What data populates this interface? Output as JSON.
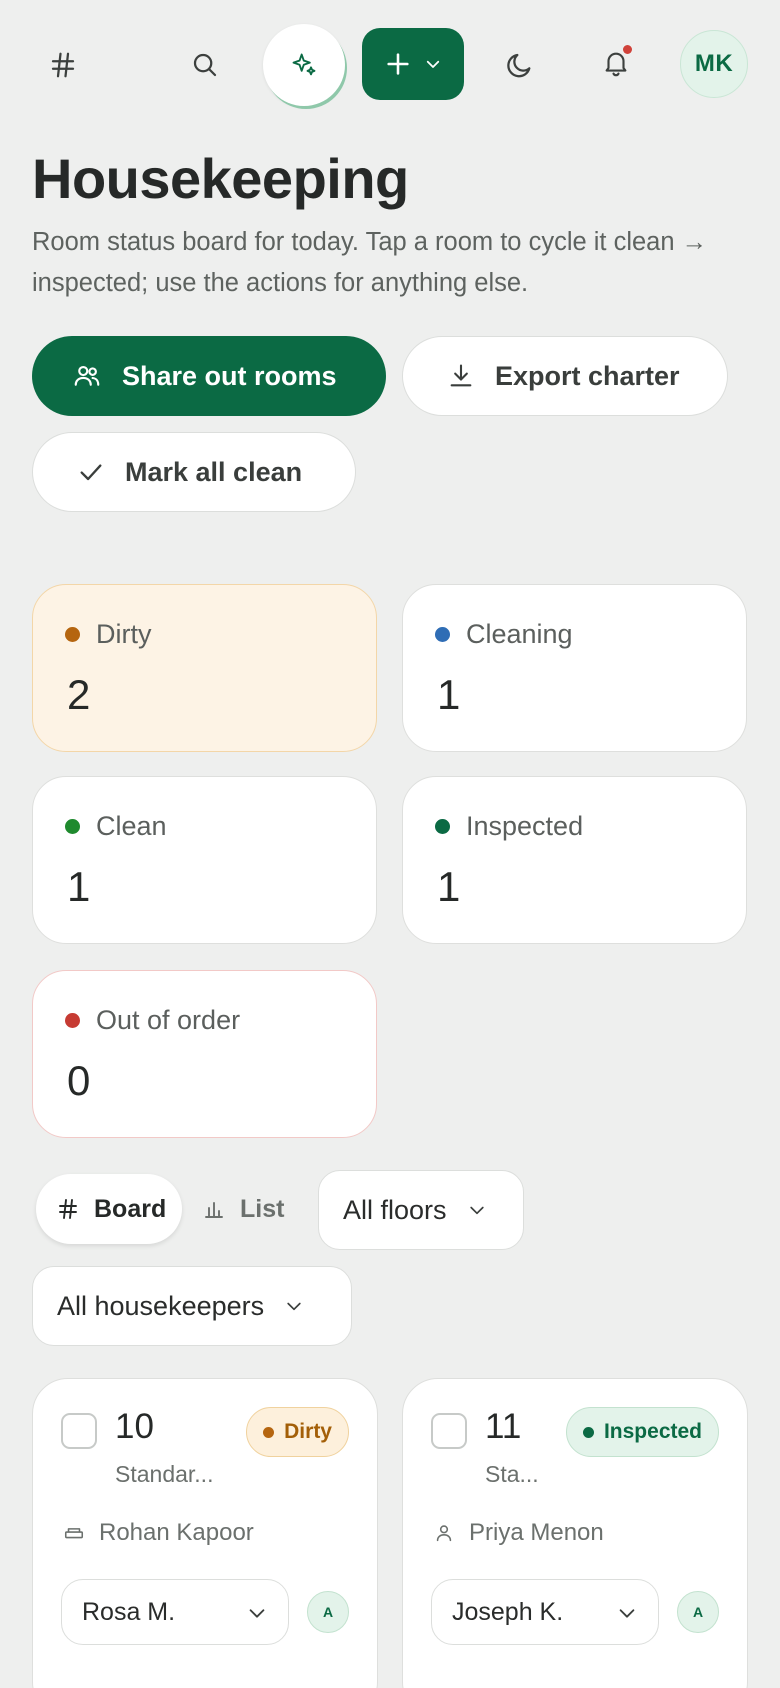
{
  "topbar": {
    "avatar_initials": "MK",
    "notification_dot_color": "#d0423a",
    "accent_color": "#0b6a44"
  },
  "header": {
    "title": "Housekeeping",
    "subtitle": "Room status board for today. Tap a room to cycle it clean → inspected; use the actions for anything else."
  },
  "actions": {
    "share_out": "Share out rooms",
    "export": "Export charter",
    "mark_all_clean": "Mark all clean"
  },
  "stats": [
    {
      "label": "Dirty",
      "value": "2",
      "color": "#b5650f"
    },
    {
      "label": "Cleaning",
      "value": "1",
      "color": "#2f6db5"
    },
    {
      "label": "Clean",
      "value": "1",
      "color": "#1f8a2e"
    },
    {
      "label": "Inspected",
      "value": "1",
      "color": "#0b6a44"
    },
    {
      "label": "Out of order",
      "value": "0",
      "color": "#c63b33"
    }
  ],
  "filters": {
    "view_board": "Board",
    "view_list": "List",
    "floors": "All floors",
    "housekeepers": "All housekeepers"
  },
  "rooms": [
    {
      "number": "10",
      "type": "Standar...",
      "status": "Dirty",
      "guest": "Rohan Kapoor",
      "housekeeper": "Rosa M.",
      "auto_label": "A"
    },
    {
      "number": "11",
      "type": "Sta...",
      "status": "Inspected",
      "guest": "Priya Menon",
      "housekeeper": "Joseph K.",
      "auto_label": "A"
    }
  ]
}
